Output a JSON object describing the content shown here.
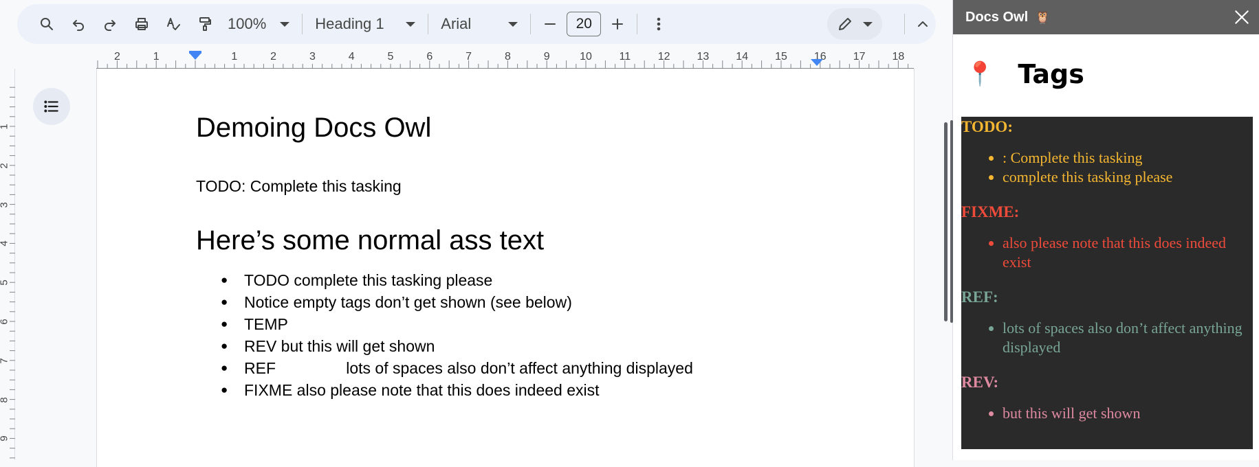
{
  "toolbar": {
    "zoom": "100%",
    "style": "Heading 1",
    "font": "Arial",
    "font_size": "20"
  },
  "ruler": {
    "horizontal_numbers": [
      "2",
      "1",
      "1",
      "2",
      "3",
      "4",
      "5",
      "6",
      "7",
      "8",
      "9",
      "10",
      "11",
      "12",
      "13",
      "14",
      "15",
      "16",
      "17",
      "18"
    ],
    "vertical_numbers": [
      "1",
      "2",
      "3",
      "4",
      "5",
      "6",
      "7",
      "8",
      "9"
    ]
  },
  "document": {
    "title": "Demoing Docs Owl",
    "todo_line": "TODO: Complete this tasking",
    "heading2": "Here’s some normal ass text",
    "bullets": [
      "TODO complete this tasking please",
      "Notice empty tags don’t get shown (see below)",
      "TEMP",
      "REV but this will get shown",
      "REF                lots of spaces also don’t affect anything displayed",
      "FIXME also please note that this does indeed exist"
    ]
  },
  "sidebar": {
    "header_title": "Docs Owl",
    "header_emoji": "🦉",
    "pin_emoji": "📍",
    "title": "Tags",
    "tags": [
      {
        "name": "TODO:",
        "color": "#f5b731",
        "items": [
          ": Complete this tasking",
          "complete this tasking please"
        ]
      },
      {
        "name": "FIXME:",
        "color": "#ef4b3b",
        "items": [
          "also please note that this does indeed exist"
        ]
      },
      {
        "name": "REF:",
        "color": "#78a596",
        "items": [
          "lots of spaces also don’t affect anything displayed"
        ]
      },
      {
        "name": "REV:",
        "color": "#e08aa2",
        "items": [
          "but this will get shown"
        ]
      }
    ]
  }
}
